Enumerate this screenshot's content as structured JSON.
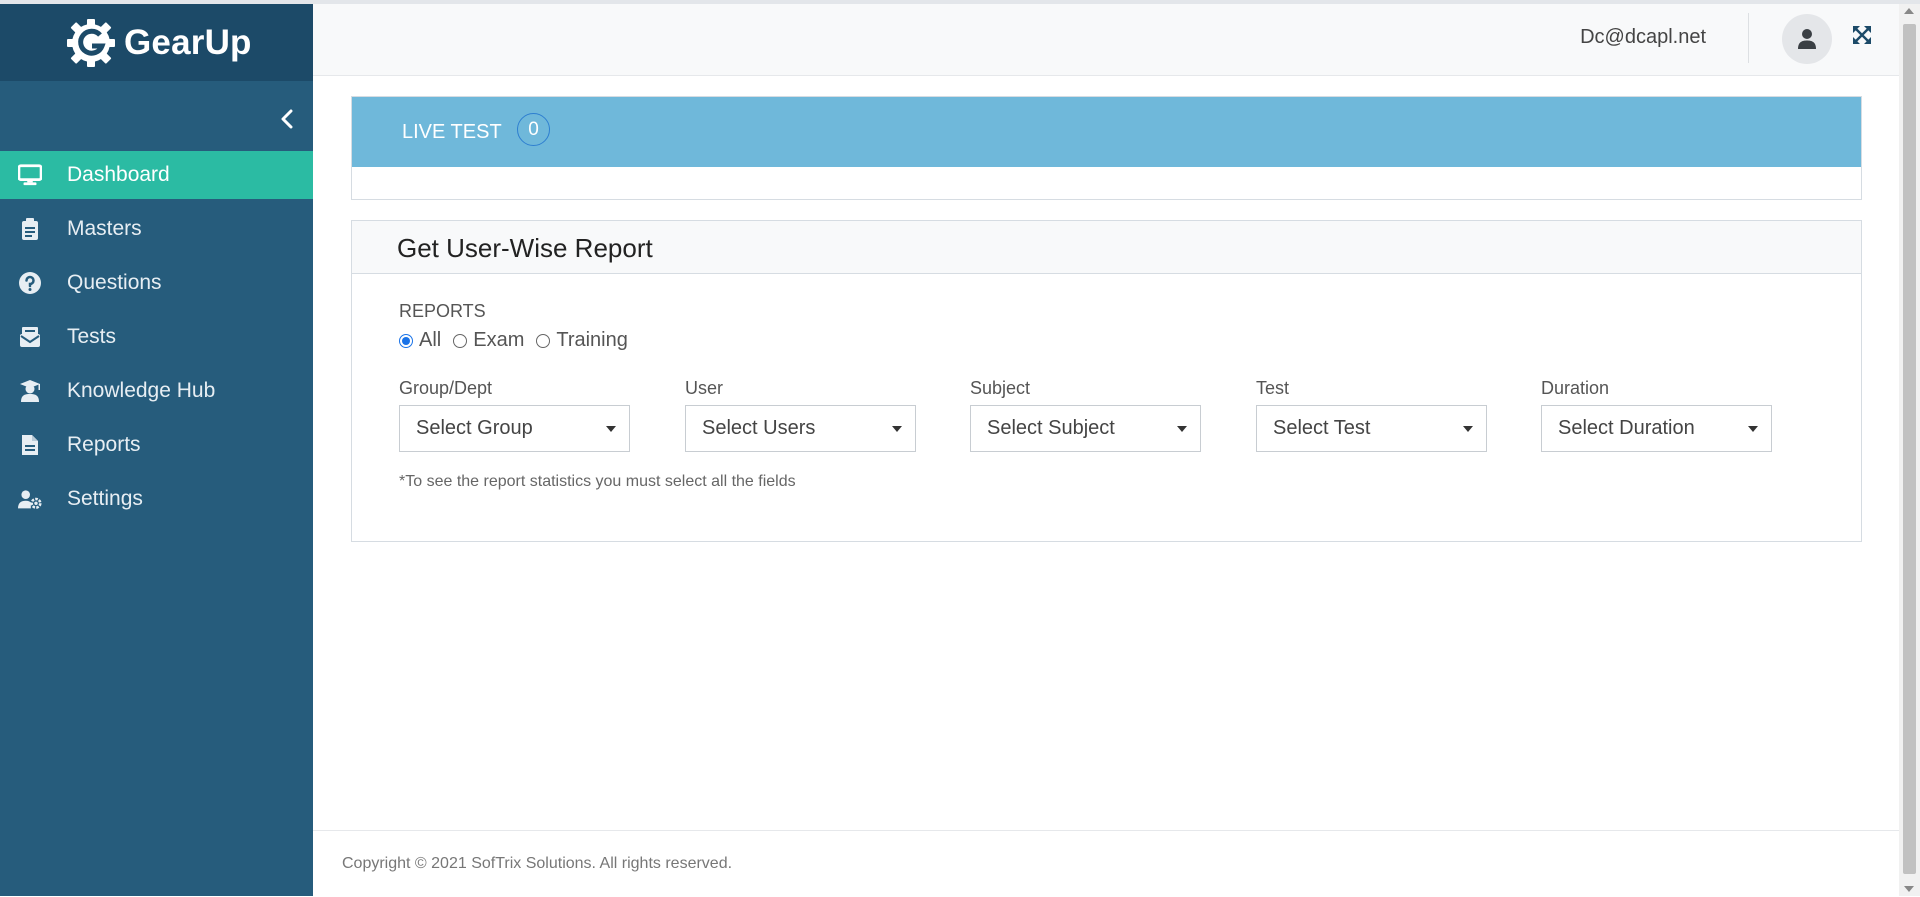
{
  "app": {
    "name": "GearUp"
  },
  "header": {
    "user_email": "Dc@dcapl.net"
  },
  "sidebar": {
    "items": [
      {
        "label": "Dashboard",
        "icon": "monitor-icon",
        "active": true
      },
      {
        "label": "Masters",
        "icon": "clipboard-icon",
        "active": false
      },
      {
        "label": "Questions",
        "icon": "question-circle-icon",
        "active": false
      },
      {
        "label": "Tests",
        "icon": "mail-bulk-icon",
        "active": false
      },
      {
        "label": "Knowledge Hub",
        "icon": "graduate-icon",
        "active": false
      },
      {
        "label": "Reports",
        "icon": "file-icon",
        "active": false
      },
      {
        "label": "Settings",
        "icon": "user-cog-icon",
        "active": false
      }
    ]
  },
  "live_test": {
    "title": "LIVE TEST",
    "count": "0"
  },
  "report": {
    "title": "Get User-Wise Report",
    "reports_label": "REPORTS",
    "options": [
      {
        "label": "All",
        "checked": true
      },
      {
        "label": "Exam",
        "checked": false
      },
      {
        "label": "Training",
        "checked": false
      }
    ],
    "fields": [
      {
        "label": "Group/Dept",
        "placeholder": "Select Group"
      },
      {
        "label": "User",
        "placeholder": "Select Users"
      },
      {
        "label": "Subject",
        "placeholder": "Select Subject"
      },
      {
        "label": "Test",
        "placeholder": "Select Test"
      },
      {
        "label": "Duration",
        "placeholder": "Select Duration"
      }
    ],
    "note": "*To see the report statistics you must select all the fields"
  },
  "footer": {
    "copyright": "Copyright © 2021 SofTrix Solutions. All rights reserved."
  },
  "colors": {
    "sidebar": "#265c7c",
    "logo_bar": "#1c4a68",
    "active_nav": "#2bbba3",
    "live_header": "#6fb8da",
    "accent": "#1a73e8"
  }
}
